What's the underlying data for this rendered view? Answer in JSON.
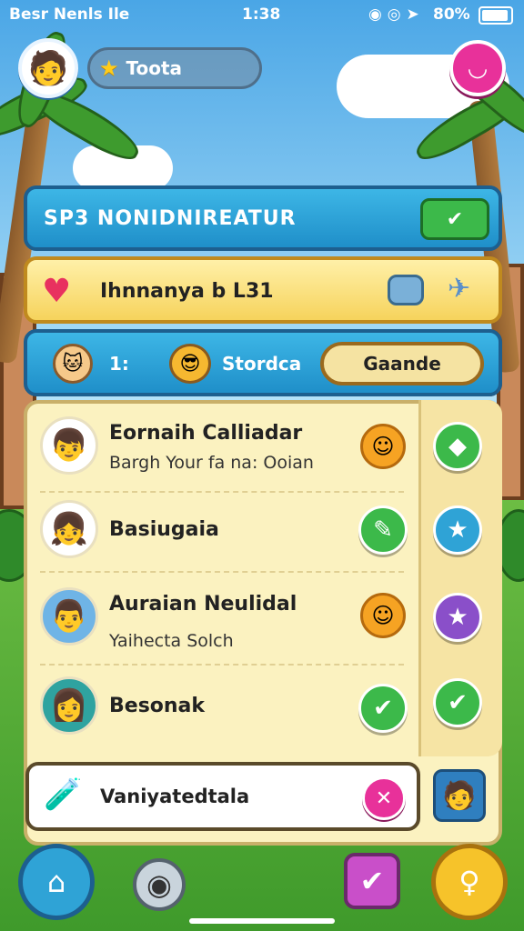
{
  "status_bar": {
    "carrier": "Besr Nenls Ile",
    "time": "1:38",
    "battery": "80%"
  },
  "header": {
    "player_name": "Toota"
  },
  "bars": {
    "title": "SP3 NONIDNIREATUR",
    "event_text": "Ihnnanya b L31",
    "count": "1:",
    "stage_label": "Stordca",
    "grade_button": "Gaande"
  },
  "list": [
    {
      "name": "Eornaih Calliadar",
      "subtitle": "Bargh Your fa na: Ooian"
    },
    {
      "name": "Basiugaia",
      "subtitle": ""
    },
    {
      "name": "Auraian Neulidal",
      "subtitle": "Yaihecta Solch"
    },
    {
      "name": "Besonak",
      "subtitle": ""
    }
  ],
  "bottom_card": {
    "text": "Vaniyatedtala"
  },
  "icons": {
    "menu": "menu-badge-icon",
    "home": "home-icon",
    "camera": "camera-icon",
    "box": "gift-box-icon",
    "trophy": "trophy-icon"
  },
  "colors": {
    "accent_blue": "#1f8fc9",
    "accent_pink": "#e8319a",
    "accent_green": "#3cb94a",
    "accent_yellow": "#f6d35c"
  }
}
